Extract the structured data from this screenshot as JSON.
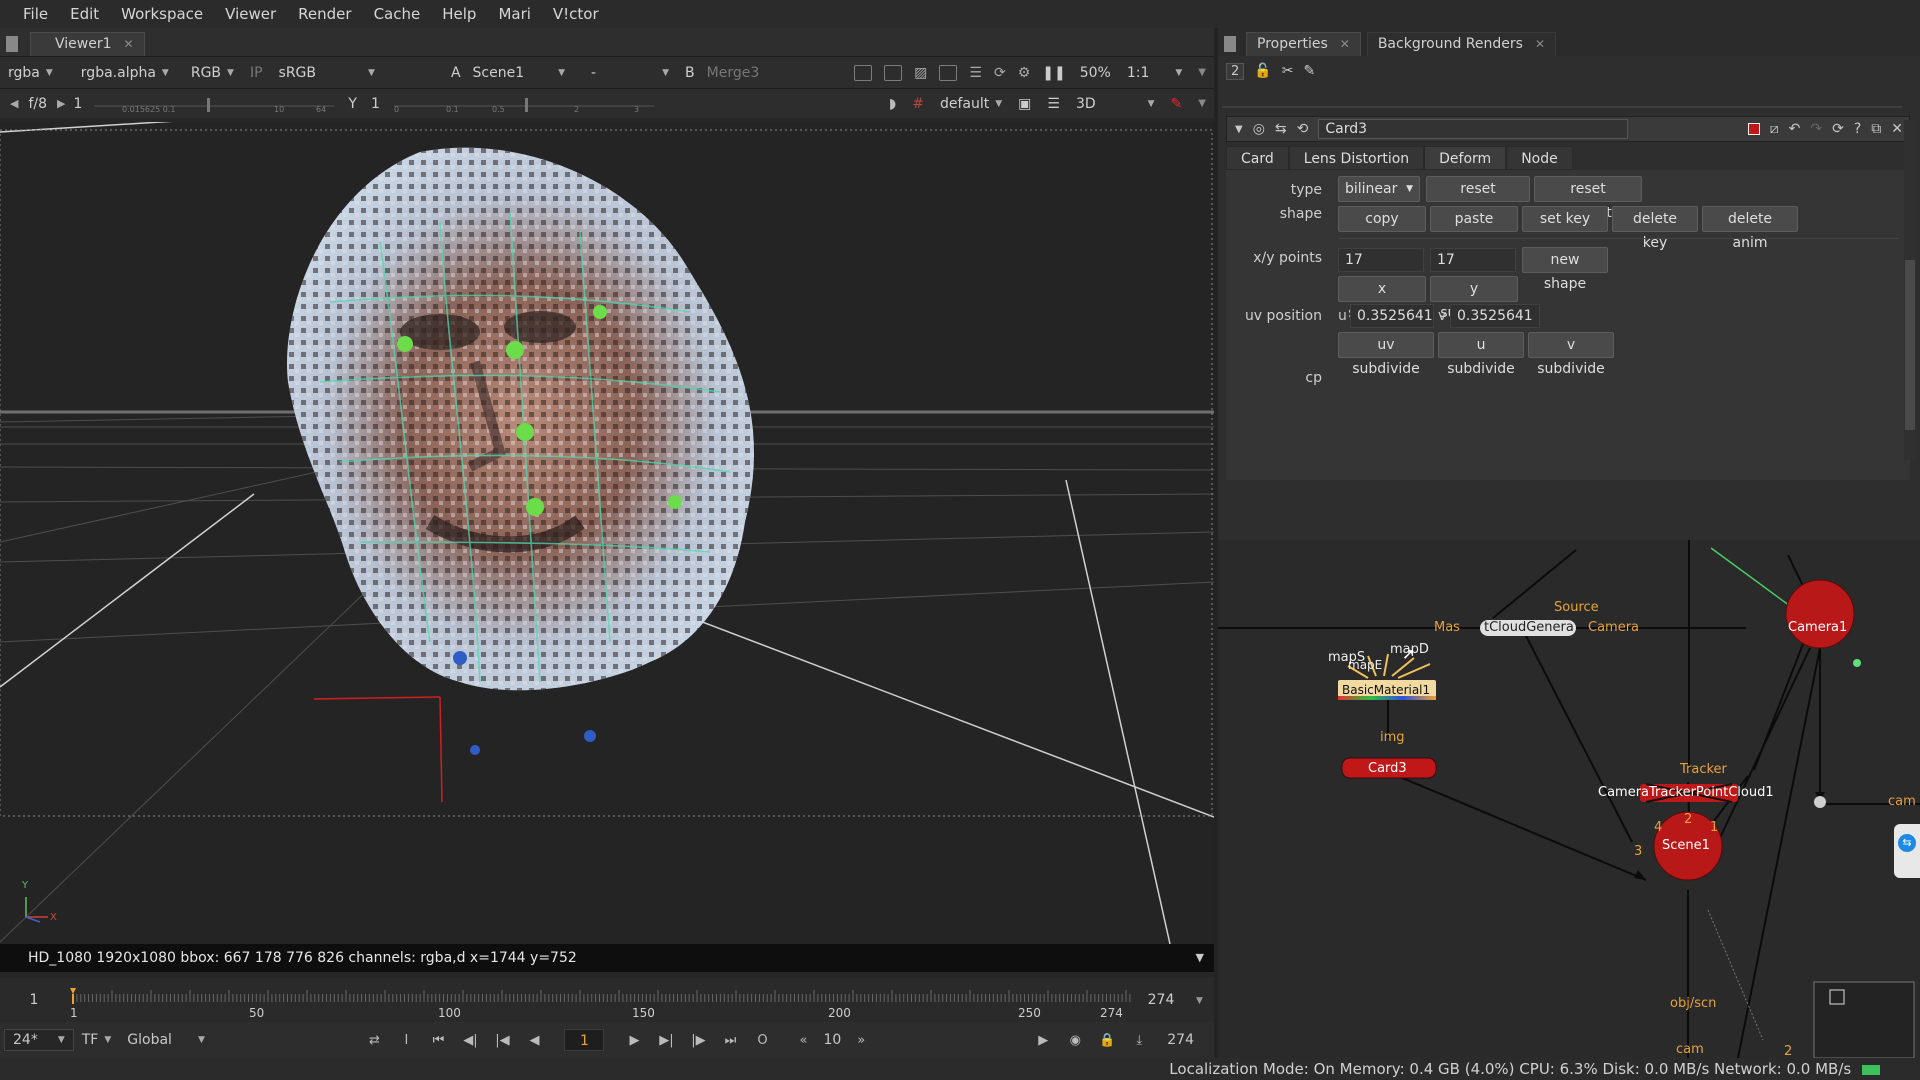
{
  "menu": [
    "File",
    "Edit",
    "Workspace",
    "Viewer",
    "Render",
    "Cache",
    "Help",
    "Mari",
    "V!ctor"
  ],
  "viewer": {
    "tab": "Viewer1",
    "toolbar1": {
      "channels": "rgba",
      "alpha": "rgba.alpha",
      "display": "RGB",
      "ip": "IP",
      "colorspace": "sRGB",
      "a_label": "A",
      "a_input": "Scene1",
      "dash": "-",
      "b_label": "B",
      "b_input": "Merge3",
      "zoom": "50%",
      "ratio": "1:1"
    },
    "toolbar2": {
      "fstop": "f/8",
      "gain": "1",
      "gamma_label": "Y",
      "gamma": "1",
      "lut": "default",
      "mode": "3D"
    },
    "axis_y": "Y",
    "axis_x": "X",
    "info": "HD_1080 1920x1080  bbox: 667 178 776 826 channels: rgba,d  x=1744 y=752",
    "timeline": {
      "start": "1",
      "ticks": [
        "1",
        "50",
        "100",
        "150",
        "200",
        "250",
        "274"
      ],
      "end": "274"
    },
    "transport": {
      "fps": "24*",
      "tf": "TF",
      "scope": "Global",
      "frame": "1",
      "step": "10",
      "last": "274"
    }
  },
  "props": {
    "tabs": [
      "Properties",
      "Background Renders"
    ],
    "count": "2",
    "node_name": "Card3",
    "node_tabs": [
      "Card",
      "Lens Distortion",
      "Deform",
      "Node"
    ],
    "active_tab": "Deform",
    "type_label": "type",
    "type_value": "bilinear",
    "reset_handles": "reset handles",
    "reset_tangents": "reset tangents",
    "shape_label": "shape",
    "copy": "copy",
    "paste": "paste",
    "set_key": "set key",
    "delete_key": "delete key",
    "delete_anim": "delete anim",
    "xy_label": "x/y points",
    "x_points": "17",
    "y_points": "17",
    "new_shape": "new shape",
    "x_subdivide": "x subdivide",
    "y_subdivide": "y subdivide",
    "uv_label": "uv position",
    "u_label": "u",
    "u_value": "0.3525641",
    "v_label": "v",
    "v_value": "0.3525641",
    "uv_subdivide": "uv subdivide",
    "u_subdivide": "u subdivide",
    "v_subdivide": "v subdivide",
    "cp_label": "cp"
  },
  "nodegraph": {
    "source": "Source",
    "cloud_left": "Mas",
    "cloud": "tCloudGenera",
    "camera_input": "Camera",
    "camera1": "Camera1",
    "mapS": "mapS",
    "mapD": "mapD",
    "mapE": "mapE",
    "basic_material": "BasicMaterial1",
    "img": "img",
    "card3": "Card3",
    "tracker": "Tracker",
    "camtracker": "CameraTrackerPointCloud1",
    "scene1": "Scene1",
    "cam_right": "cam",
    "obj_scn": "obj/scn",
    "cam_bottom": "cam",
    "in4": "4",
    "in3": "3",
    "in2": "2",
    "in1": "1",
    "in2b": "2"
  },
  "status": "Localization Mode: On Memory: 0.4 GB (4.0%) CPU: 6.3% Disk: 0.0 MB/s Network: 0.0 MB/s",
  "colors": {
    "accent_orange": "#e8a23a",
    "node_red": "#c01818",
    "grid": "#5a5a5a"
  }
}
